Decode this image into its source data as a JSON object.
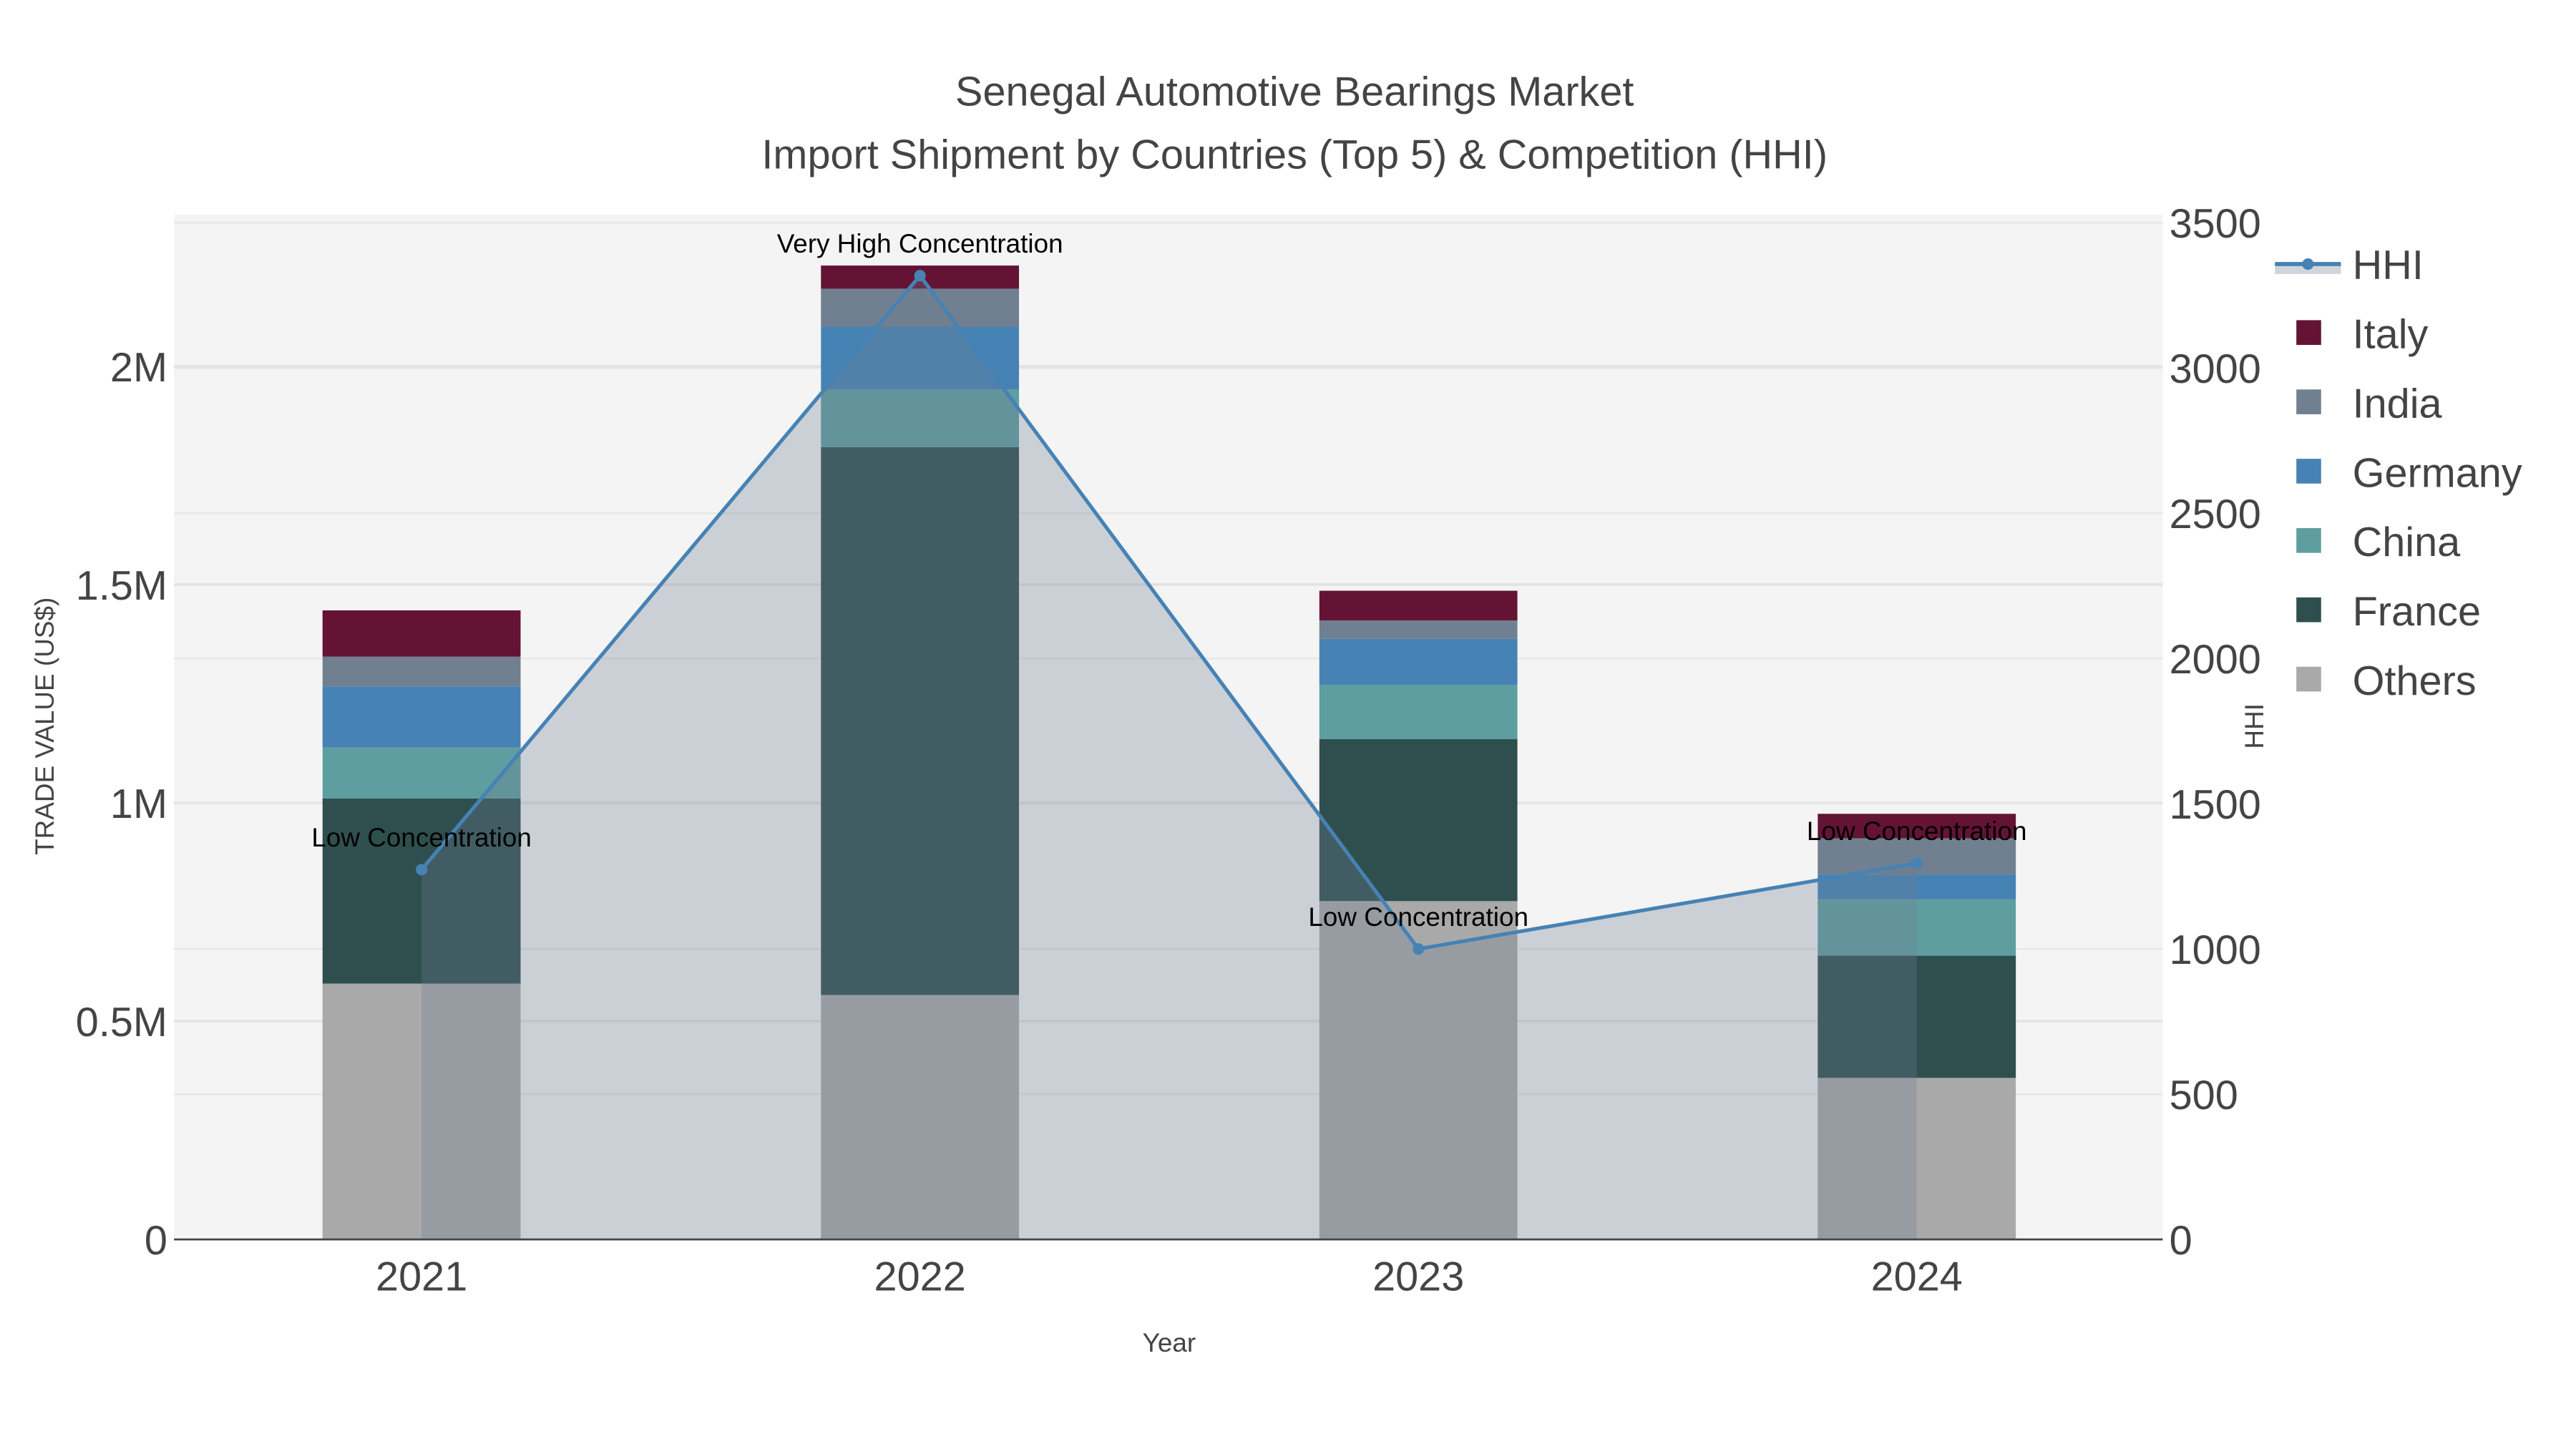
{
  "chart_data": {
    "type": "bar",
    "title": "Senegal Automotive Bearings Market",
    "subtitle": "Import Shipment by Countries (Top 5) & Competition (HHI)",
    "xlabel": "Year",
    "ylabel": "TRADE VALUE (US$)",
    "y2label": "HHI",
    "ylim": [
      0,
      2350000
    ],
    "y2lim": [
      0,
      3550
    ],
    "yticks": [
      {
        "v": 0,
        "label": "0"
      },
      {
        "v": 500000,
        "label": "0.5M"
      },
      {
        "v": 1000000,
        "label": "1M"
      },
      {
        "v": 1500000,
        "label": "1.5M"
      },
      {
        "v": 2000000,
        "label": "2M"
      }
    ],
    "y2ticks": [
      {
        "v": 0,
        "label": "0"
      },
      {
        "v": 500,
        "label": "500"
      },
      {
        "v": 1000,
        "label": "1000"
      },
      {
        "v": 1500,
        "label": "1500"
      },
      {
        "v": 2000,
        "label": "2000"
      },
      {
        "v": 2500,
        "label": "2500"
      },
      {
        "v": 3000,
        "label": "3000"
      },
      {
        "v": 3500,
        "label": "3500"
      }
    ],
    "categories": [
      "2021",
      "2022",
      "2023",
      "2024"
    ],
    "series": [
      {
        "name": "Others",
        "color": "#a9a9a9",
        "values": [
          586000,
          560000,
          775000,
          370000
        ]
      },
      {
        "name": "France",
        "color": "#2f4f4f",
        "values": [
          424000,
          1255000,
          371000,
          280000
        ]
      },
      {
        "name": "China",
        "color": "#5f9ea0",
        "values": [
          117000,
          132000,
          124000,
          129000
        ]
      },
      {
        "name": "Germany",
        "color": "#4682b4",
        "values": [
          140000,
          144000,
          106000,
          57000
        ]
      },
      {
        "name": "India",
        "color": "#708090",
        "values": [
          68000,
          87000,
          42000,
          83000
        ]
      },
      {
        "name": "Italy",
        "color": "#641334",
        "values": [
          106000,
          53000,
          68000,
          56000
        ]
      }
    ],
    "hhi": {
      "name": "HHI",
      "color": "#4682b4",
      "values": [
        1273,
        3318,
        1000,
        1295
      ],
      "annotations": [
        "Low Concentration",
        "Very High Concentration",
        "Low Concentration",
        "Low Concentration"
      ]
    },
    "legend": [
      "HHI",
      "Italy",
      "India",
      "Germany",
      "China",
      "France",
      "Others"
    ],
    "legend_position": "right",
    "grid": true
  }
}
